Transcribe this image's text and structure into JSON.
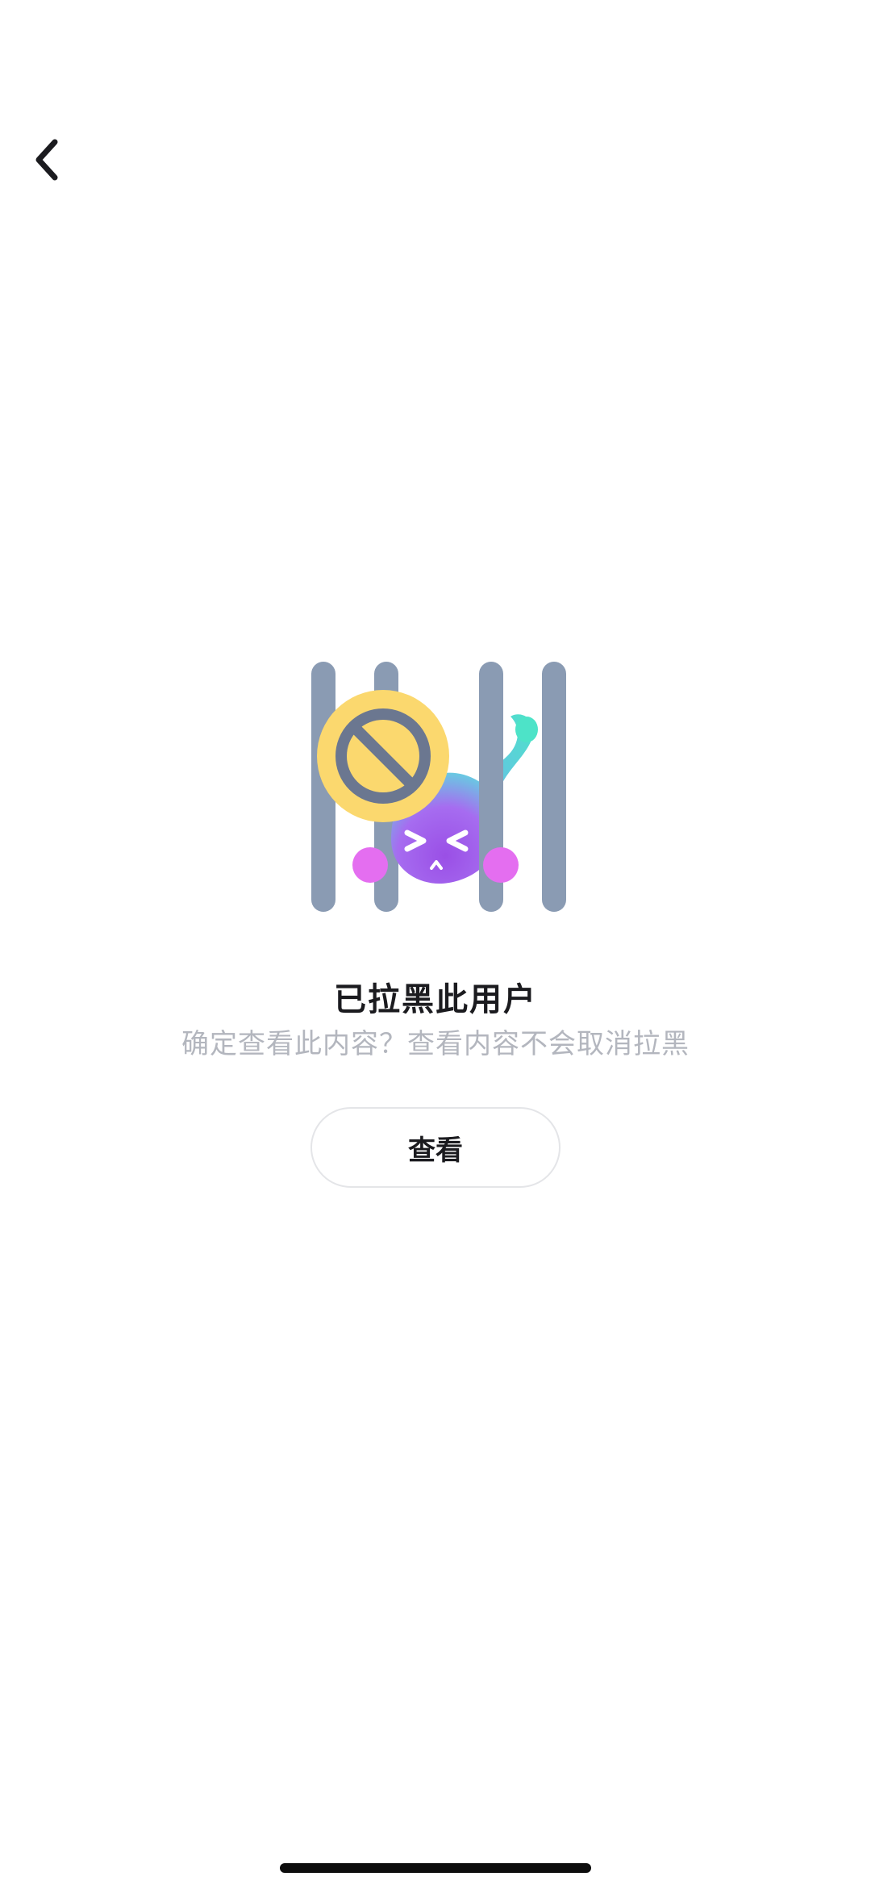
{
  "header": {
    "back_icon": "chevron-left-icon"
  },
  "empty_state": {
    "illustration_icon": "blocked-user-cage-illustration",
    "title": "已拉黑此用户",
    "subtitle": "确定查看此内容？查看内容不会取消拉黑",
    "view_button_label": "查看"
  },
  "colors": {
    "background": "#ffffff",
    "title": "#1b1b1f",
    "subtitle": "#b3b6be",
    "bars": "#8a9bb3",
    "badge_yellow": "#fbd86e",
    "badge_ring": "#6b7790",
    "creature_purple": "#a455e8",
    "creature_teal": "#4de3c8",
    "creature_pink": "#e46ef0",
    "button_border": "#e4e5e8"
  }
}
